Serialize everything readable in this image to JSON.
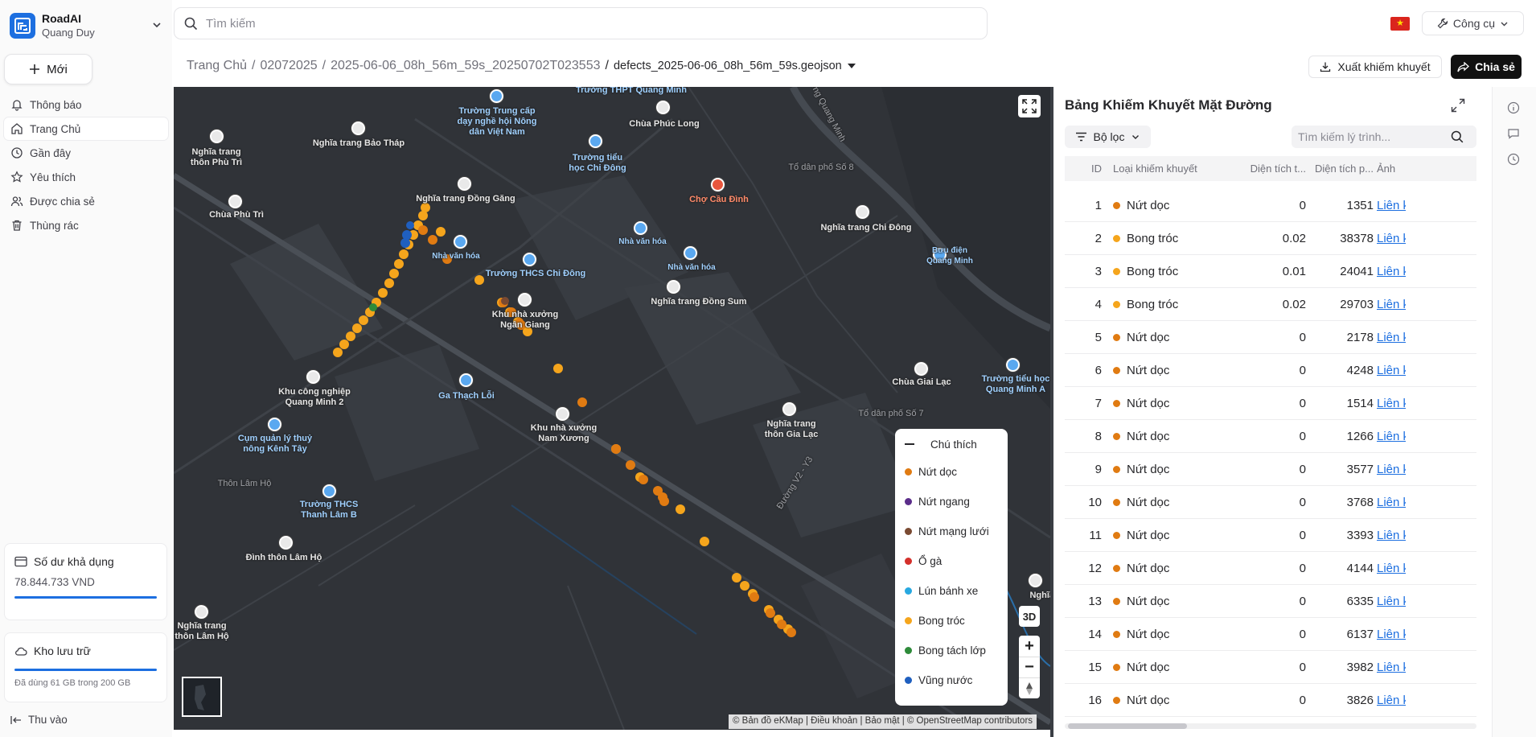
{
  "app": {
    "name": "RoadAI",
    "user": "Quang Duy",
    "new_label": "Mới"
  },
  "nav": [
    {
      "label": "Thông báo",
      "icon": "bell-icon"
    },
    {
      "label": "Trang Chủ",
      "icon": "home-icon",
      "active": true
    },
    {
      "label": "Gần đây",
      "icon": "clock-icon"
    },
    {
      "label": "Yêu thích",
      "icon": "star-icon"
    },
    {
      "label": "Được chia sẻ",
      "icon": "users-icon"
    },
    {
      "label": "Thùng rác",
      "icon": "trash-icon"
    }
  ],
  "balance": {
    "title": "Số dư khả dụng",
    "value": "78.844.733 VND"
  },
  "storage": {
    "title": "Kho lưu trữ",
    "usage": "Đã dùng 61 GB trong 200 GB",
    "used_fraction": 0.305
  },
  "collapse_label": "Thu vào",
  "search": {
    "placeholder": "Tìm kiếm"
  },
  "tools_label": "Công cụ",
  "breadcrumb": {
    "items": [
      "Trang Chủ",
      "02072025",
      "2025-06-06_08h_56m_59s_20250702T023553"
    ],
    "current": "defects_2025-06-06_08h_56m_59s.geojson"
  },
  "actions": {
    "export": "Xuất khiếm khuyết",
    "share": "Chia sẻ"
  },
  "map": {
    "places": [
      {
        "name": "Trường THPT\nQuang Minh",
        "kind": "blue"
      },
      {
        "name": "Trường Trung cấp\ndạy nghề hội Nông\ndân Việt Nam",
        "kind": "blue"
      },
      {
        "name": "Chùa Phúc Long",
        "kind": "white"
      },
      {
        "name": "Nghĩa trang\nthôn Phù Trì",
        "kind": "white"
      },
      {
        "name": "Nghĩa trang Bảo Tháp",
        "kind": "white"
      },
      {
        "name": "Trường tiểu\nhọc Chi Đông",
        "kind": "blue"
      },
      {
        "name": "Tổ dân phố Số 8",
        "kind": "dim"
      },
      {
        "name": "Chùa Phù Trì",
        "kind": "white"
      },
      {
        "name": "Nghĩa trang Đồng Găng",
        "kind": "white"
      },
      {
        "name": "Chợ Cầu Đình",
        "kind": "red"
      },
      {
        "name": "Nghĩa trang Chi Đông",
        "kind": "white"
      },
      {
        "name": "Bưu điện\nQuang Minh",
        "kind": "blue"
      },
      {
        "name": "Nhà văn hóa",
        "kind": "blue"
      },
      {
        "name": "Nhà văn hóa",
        "kind": "blue"
      },
      {
        "name": "Nhà văn hóa",
        "kind": "blue"
      },
      {
        "name": "Trường THCS Chi Đông",
        "kind": "blue"
      },
      {
        "name": "Nghĩa trang Đồng Sum",
        "kind": "white"
      },
      {
        "name": "Khu nhà xưởng\nNgân Giang",
        "kind": "white"
      },
      {
        "name": "Khu công nghiệp\nQuang Minh 2",
        "kind": "white"
      },
      {
        "name": "Ga Thạch Lỗi",
        "kind": "blue"
      },
      {
        "name": "Chùa Giai Lạc",
        "kind": "white"
      },
      {
        "name": "Trường tiểu học\nQuang Minh A",
        "kind": "blue"
      },
      {
        "name": "Khu nhà xưởng\nNam Xương",
        "kind": "white"
      },
      {
        "name": "Nghĩa trang\nthôn Gia Lạc",
        "kind": "white"
      },
      {
        "name": "Tổ dân phố Số 7",
        "kind": "dim"
      },
      {
        "name": "Cụm quản lý thuỷ\nnông Kênh Tây",
        "kind": "blue"
      },
      {
        "name": "Thôn Lâm Hộ",
        "kind": "dim"
      },
      {
        "name": "Trường THCS\nThanh Lâm B",
        "kind": "blue"
      },
      {
        "name": "Đình thôn Lâm Hộ",
        "kind": "white"
      },
      {
        "name": "Nghĩa trang\nthôn Lâm Hộ",
        "kind": "white"
      },
      {
        "name": "Nghĩa trang",
        "kind": "white"
      },
      {
        "name": "Đường V2 - Y3",
        "kind": "dim"
      },
      {
        "name": "Đường Quang Minh",
        "kind": "dim"
      }
    ],
    "btn_3d": "3D",
    "zoom_in": "+",
    "zoom_out": "−",
    "attribution": "© Bản đồ eKMap | Điều khoản | Bảo mật | © OpenStreetMap contributors",
    "legend": {
      "title": "Chú thích",
      "items": [
        {
          "label": "Nứt dọc",
          "color": "#e07b12"
        },
        {
          "label": "Nứt ngang",
          "color": "#5b2d8a"
        },
        {
          "label": "Nứt mạng lưới",
          "color": "#7a4a32"
        },
        {
          "label": "Ổ gà",
          "color": "#d4302b"
        },
        {
          "label": "Lún bánh xe",
          "color": "#27a8e0"
        },
        {
          "label": "Bong tróc",
          "color": "#f5a51c"
        },
        {
          "label": "Bong tách lớp",
          "color": "#2e8b3a"
        },
        {
          "label": "Vũng nước",
          "color": "#1f5fbf"
        }
      ]
    }
  },
  "panel": {
    "title": "Bảng Khiếm Khuyết Mặt Đường",
    "filter_label": "Bộ lọc",
    "search_placeholder": "Tìm kiếm lý trình...",
    "columns": [
      "ID",
      "Loại khiếm khuyết",
      "Diện tích t...",
      "Diện tích p...",
      "Ảnh"
    ],
    "rows": [
      {
        "id": "1",
        "type": "Nứt dọc",
        "color": "#e07b12",
        "a": "0",
        "b": "1351",
        "img": "Liên kết"
      },
      {
        "id": "2",
        "type": "Bong tróc",
        "color": "#f5a51c",
        "a": "0.02",
        "b": "38378",
        "img": "Liên kết"
      },
      {
        "id": "3",
        "type": "Bong tróc",
        "color": "#f5a51c",
        "a": "0.01",
        "b": "24041",
        "img": "Liên kết"
      },
      {
        "id": "4",
        "type": "Bong tróc",
        "color": "#f5a51c",
        "a": "0.02",
        "b": "29703",
        "img": "Liên kết"
      },
      {
        "id": "5",
        "type": "Nứt dọc",
        "color": "#e07b12",
        "a": "0",
        "b": "2178",
        "img": "Liên kết"
      },
      {
        "id": "6",
        "type": "Nứt dọc",
        "color": "#e07b12",
        "a": "0",
        "b": "4248",
        "img": "Liên kết"
      },
      {
        "id": "7",
        "type": "Nứt dọc",
        "color": "#e07b12",
        "a": "0",
        "b": "1514",
        "img": "Liên kết"
      },
      {
        "id": "8",
        "type": "Nứt dọc",
        "color": "#e07b12",
        "a": "0",
        "b": "1266",
        "img": "Liên kết"
      },
      {
        "id": "9",
        "type": "Nứt dọc",
        "color": "#e07b12",
        "a": "0",
        "b": "3577",
        "img": "Liên kết"
      },
      {
        "id": "10",
        "type": "Nứt dọc",
        "color": "#e07b12",
        "a": "0",
        "b": "3768",
        "img": "Liên kết"
      },
      {
        "id": "11",
        "type": "Nứt dọc",
        "color": "#e07b12",
        "a": "0",
        "b": "3393",
        "img": "Liên kết"
      },
      {
        "id": "12",
        "type": "Nứt dọc",
        "color": "#e07b12",
        "a": "0",
        "b": "4144",
        "img": "Liên kết"
      },
      {
        "id": "13",
        "type": "Nứt dọc",
        "color": "#e07b12",
        "a": "0",
        "b": "6335",
        "img": "Liên kết"
      },
      {
        "id": "14",
        "type": "Nứt dọc",
        "color": "#e07b12",
        "a": "0",
        "b": "6137",
        "img": "Liên kết"
      },
      {
        "id": "15",
        "type": "Nứt dọc",
        "color": "#e07b12",
        "a": "0",
        "b": "3982",
        "img": "Liên kết"
      },
      {
        "id": "16",
        "type": "Nứt dọc",
        "color": "#e07b12",
        "a": "0",
        "b": "3826",
        "img": "Liên kết"
      }
    ]
  }
}
